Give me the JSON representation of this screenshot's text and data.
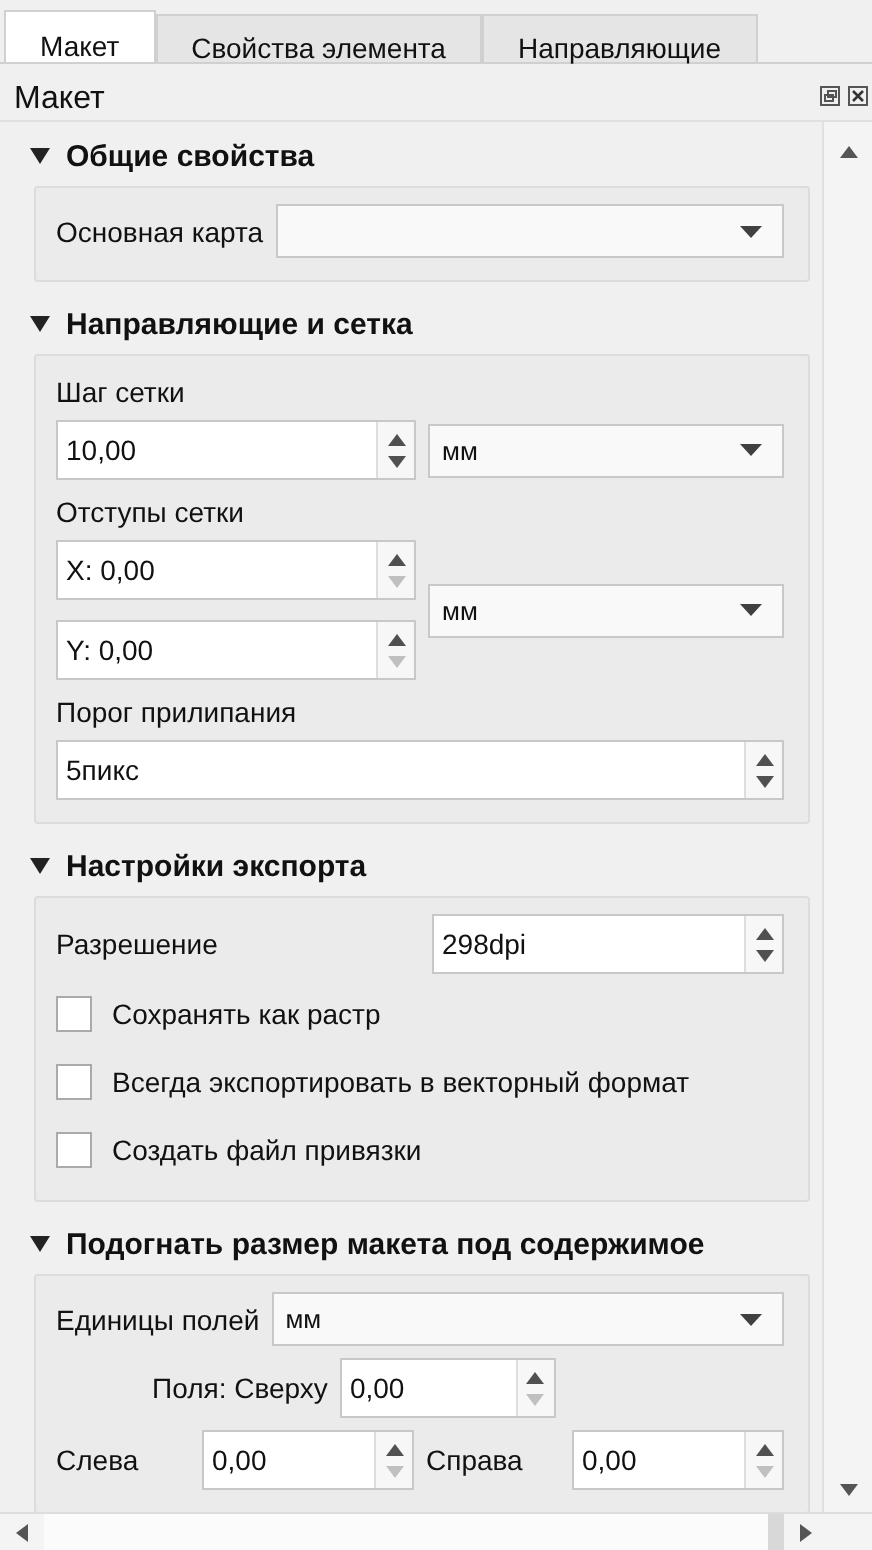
{
  "tabs": [
    {
      "label": "Макет",
      "selected": true
    },
    {
      "label": "Свойства элемента",
      "selected": false
    },
    {
      "label": "Направляющие",
      "selected": false
    }
  ],
  "panel": {
    "title": "Макет"
  },
  "sections": [
    {
      "title": "Общие свойства",
      "expanded": true,
      "rows": [
        {
          "kind": "combo-row",
          "label": "Основная карта"
        }
      ]
    },
    {
      "title": "Направляющие и сетка",
      "expanded": true,
      "rows": [
        {
          "kind": "label",
          "label": "Шаг сетки"
        },
        {
          "kind": "spin-combo",
          "spin": {
            "value": "10,00",
            "down_disabled": false
          },
          "combo": "мм"
        },
        {
          "kind": "label",
          "label": "Отступы сетки"
        },
        {
          "kind": "offset",
          "spins": [
            {
              "value": "X: 0,00",
              "down_disabled": true
            },
            {
              "value": "Y: 0,00",
              "down_disabled": true
            }
          ],
          "combo": "мм"
        },
        {
          "kind": "label",
          "label": "Порог прилипания"
        },
        {
          "kind": "spin",
          "spin": {
            "value": "5пикс",
            "down_disabled": false
          }
        }
      ]
    },
    {
      "title": "Настройки экспорта",
      "expanded": true,
      "rows": [
        {
          "kind": "spin-row",
          "label": "Разрешение",
          "spin": {
            "value": "298dpi",
            "down_disabled": false
          }
        },
        {
          "kind": "checkbox",
          "label": "Сохранять как растр",
          "checked": false
        },
        {
          "kind": "checkbox",
          "label": "Всегда экспортировать в векторный формат",
          "checked": false
        },
        {
          "kind": "checkbox",
          "label": "Создать файл привязки",
          "checked": false
        }
      ]
    },
    {
      "title": "Подогнать размер макета под содержимое",
      "expanded": true,
      "rows": [
        {
          "kind": "combo-row",
          "label": "Единицы полей",
          "value": "мм"
        },
        {
          "kind": "centered-spin",
          "label": "Поля: Сверху",
          "spin": {
            "value": "0,00",
            "down_disabled": true
          }
        },
        {
          "kind": "spin-pair",
          "items": [
            {
              "label": "Слева",
              "spin": {
                "value": "0,00",
                "down_disabled": true
              }
            },
            {
              "label": "Справа",
              "spin": {
                "value": "0,00",
                "down_disabled": true
              }
            }
          ]
        }
      ]
    }
  ]
}
